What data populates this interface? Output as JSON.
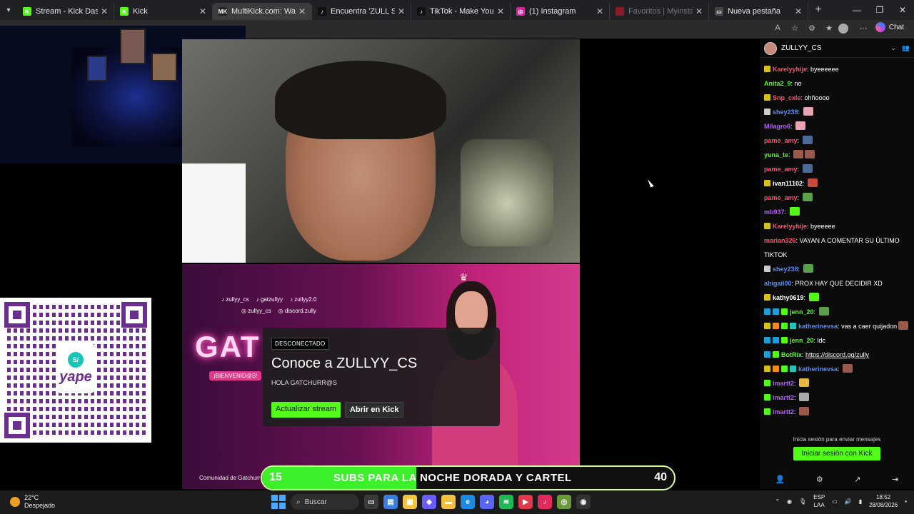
{
  "browser": {
    "tabs": [
      {
        "title": "Stream - Kick Dashboard",
        "fav_color": "#53fc18",
        "fav_glyph": "K",
        "active": false,
        "dim": false,
        "width": 136
      },
      {
        "title": "Kick",
        "fav_color": "#53fc18",
        "fav_glyph": "K",
        "active": false,
        "dim": false,
        "width": 138
      },
      {
        "title": "MultiKick.com: Watch M",
        "fav_color": "#222222",
        "fav_glyph": "MK",
        "active": true,
        "dim": false,
        "width": 139
      },
      {
        "title": "Encuentra 'ZULL SIDERAL' e",
        "fav_color": "#111111",
        "fav_glyph": "♪",
        "active": false,
        "dim": false,
        "width": 139
      },
      {
        "title": "TikTok - Make Your Day",
        "fav_color": "#111111",
        "fav_glyph": "♪",
        "active": false,
        "dim": false,
        "width": 139
      },
      {
        "title": "(1) Instagram",
        "fav_color": "#d6249f",
        "fav_glyph": "◎",
        "active": false,
        "dim": false,
        "width": 139
      },
      {
        "title": "Favoritos | Myinstants",
        "fav_color": "#8b1a2b",
        "fav_glyph": "",
        "active": false,
        "dim": true,
        "width": 139
      },
      {
        "title": "Nueva pestaña",
        "fav_color": "#444444",
        "fav_glyph": "▭",
        "active": false,
        "dim": false,
        "width": 139
      }
    ],
    "chat_label": "Chat"
  },
  "offline_screen": {
    "socials_row1": [
      "zullyy_cs",
      "gatzullyy",
      "zullyy2.0"
    ],
    "socials_row2": [
      "zullyy_cs",
      "discord.zully"
    ],
    "gat_text": "GAT",
    "bienvenidos": "¡BIENVENID@S!",
    "comunidad": "Comunidad de Gatchurr"
  },
  "card": {
    "badge": "DESCONECTADO",
    "title": "Conoce a ZULLYY_CS",
    "subtitle": "HOLA GATCHURR@S",
    "btn_refresh": "Actualizar stream",
    "btn_open": "Abrir en Kick"
  },
  "goal_bar": {
    "current": "15",
    "label": "SUBS PARA LA NOCHE DORADA Y CARTEL",
    "goal": "40",
    "progress": 0.375
  },
  "qr": {
    "brand": "yape",
    "badge": "S/"
  },
  "chat": {
    "channel": "ZULLYY_CS",
    "messages": [
      {
        "badges": [
          "#d4c21a"
        ],
        "user": "Karelyyhije",
        "color": "#ff4d6d",
        "text": "byeeeeee",
        "emotes": []
      },
      {
        "badges": [],
        "user": "Anita2_9",
        "color": "#53fc18",
        "text": "no",
        "emotes": []
      },
      {
        "badges": [
          "#d4c21a"
        ],
        "user": "Snp_cxle",
        "color": "#ff4d6d",
        "text": "ohñoooo",
        "emotes": []
      },
      {
        "badges": [
          "#cccccc"
        ],
        "user": "shey238",
        "color": "#4f8dff",
        "text": "",
        "emotes": [
          "#e9a3b4"
        ]
      },
      {
        "badges": [],
        "user": "Milagro6",
        "color": "#b45cff",
        "text": "",
        "emotes": [
          "#e9a3b4"
        ]
      },
      {
        "badges": [],
        "user": "pame_amy",
        "color": "#ff4d6d",
        "text": "",
        "emotes": [
          "#4a6a9a"
        ]
      },
      {
        "badges": [],
        "user": "yuna_te",
        "color": "#53fc18",
        "text": "",
        "emotes": [
          "#9a5a4a",
          "#9a5a4a"
        ]
      },
      {
        "badges": [],
        "user": "pame_amy",
        "color": "#ff4d6d",
        "text": "",
        "emotes": [
          "#4a6a9a"
        ]
      },
      {
        "badges": [
          "#d4c21a"
        ],
        "user": "ivan11102",
        "color": "#ffffff",
        "text": "",
        "emotes": [
          "#c94a3a"
        ]
      },
      {
        "badges": [],
        "user": "pame_amy",
        "color": "#ff4d6d",
        "text": "",
        "emotes": [
          "#5aa04a"
        ]
      },
      {
        "badges": [],
        "user": "mb937",
        "color": "#b45cff",
        "text": "",
        "emotes": [
          "#53fc18"
        ]
      },
      {
        "badges": [
          "#d4c21a"
        ],
        "user": "Karelyyhije",
        "color": "#ff4d6d",
        "text": "byeeeee",
        "emotes": []
      },
      {
        "badges": [],
        "user": "marian326",
        "color": "#ff4d6d",
        "text": "VAYAN A COMENTAR SU ÚLTIMO TIKTOK",
        "emotes": [],
        "wrap": true
      },
      {
        "badges": [
          "#cccccc"
        ],
        "user": "shey238",
        "color": "#4f8dff",
        "text": "",
        "emotes": [
          "#5aa04a"
        ]
      },
      {
        "badges": [],
        "user": "abigail00",
        "color": "#4f8dff",
        "text": "PROX HAY QUE DECIDIR XD",
        "emotes": []
      },
      {
        "badges": [
          "#d4c21a"
        ],
        "user": "kathy0619",
        "color": "#ffffff",
        "text": "",
        "emotes": [
          "#53fc18"
        ]
      },
      {
        "badges": [
          "#1e9fd4",
          "#1e9fd4",
          "#53fc18"
        ],
        "user": "jenn_20",
        "color": "#53fc18",
        "text": "",
        "emotes": [
          "#5aa04a"
        ]
      },
      {
        "badges": [
          "#d4c21a",
          "#f08a1a",
          "#53fc18",
          "#26c2b3"
        ],
        "user": "katherinevsa",
        "color": "#4f8dff",
        "text": "vas a caer quijadon",
        "emotes": [
          "#9a5a4a"
        ],
        "wrap": true
      },
      {
        "badges": [
          "#1e9fd4",
          "#1e9fd4",
          "#53fc18"
        ],
        "user": "jenn_20",
        "color": "#53fc18",
        "text": "ldc",
        "emotes": []
      },
      {
        "badges": [
          "#1e9fd4",
          "#53fc18"
        ],
        "user": "BotRix",
        "color": "#53fc18",
        "text": "https://discord.gg/zully",
        "emotes": [],
        "link": true
      },
      {
        "badges": [
          "#d4c21a",
          "#f08a1a",
          "#53fc18",
          "#26c2b3"
        ],
        "user": "katherinevsa",
        "color": "#4f8dff",
        "text": "",
        "emotes": [
          "#9a5a4a"
        ]
      },
      {
        "badges": [
          "#53fc18"
        ],
        "user": "imartt2",
        "color": "#b45cff",
        "text": "",
        "emotes": [
          "#e6b840"
        ]
      },
      {
        "badges": [
          "#53fc18"
        ],
        "user": "imartt2",
        "color": "#b45cff",
        "text": "",
        "emotes": [
          "#aaaaaa"
        ]
      },
      {
        "badges": [
          "#53fc18"
        ],
        "user": "imartt2",
        "color": "#b45cff",
        "text": "",
        "emotes": [
          "#9a5a4a"
        ]
      }
    ],
    "login_hint": "Inicia sesión para enviar mensajes",
    "login_btn": "Iniciar sesión con Kick"
  },
  "taskbar": {
    "temp": "22°C",
    "weather": "Despejado",
    "search_label": "Buscar",
    "lang1": "ESP",
    "lang2": "LAA",
    "time": "18:52",
    "date": "28/08/2026",
    "apps": [
      {
        "name": "task-view",
        "color": "#3a3a3a",
        "glyph": "▭"
      },
      {
        "name": "notepad",
        "color": "#3b7ddd",
        "glyph": "▤"
      },
      {
        "name": "store",
        "color": "#f3c340",
        "glyph": "▦"
      },
      {
        "name": "copilot",
        "color": "#6a5cff",
        "glyph": "◆"
      },
      {
        "name": "explorer",
        "color": "#f0c040",
        "glyph": "▬"
      },
      {
        "name": "edge",
        "color": "#1d8ae0",
        "glyph": "e"
      },
      {
        "name": "discord",
        "color": "#5865f2",
        "glyph": "◕"
      },
      {
        "name": "spotify",
        "color": "#1db954",
        "glyph": "≋"
      },
      {
        "name": "app-red",
        "color": "#e03a4a",
        "glyph": "▶"
      },
      {
        "name": "tiktok",
        "color": "#e02a5a",
        "glyph": "♪"
      },
      {
        "name": "chrome",
        "color": "#6a9a3a",
        "glyph": "◎"
      },
      {
        "name": "obs",
        "color": "#333333",
        "glyph": "◉"
      }
    ]
  }
}
